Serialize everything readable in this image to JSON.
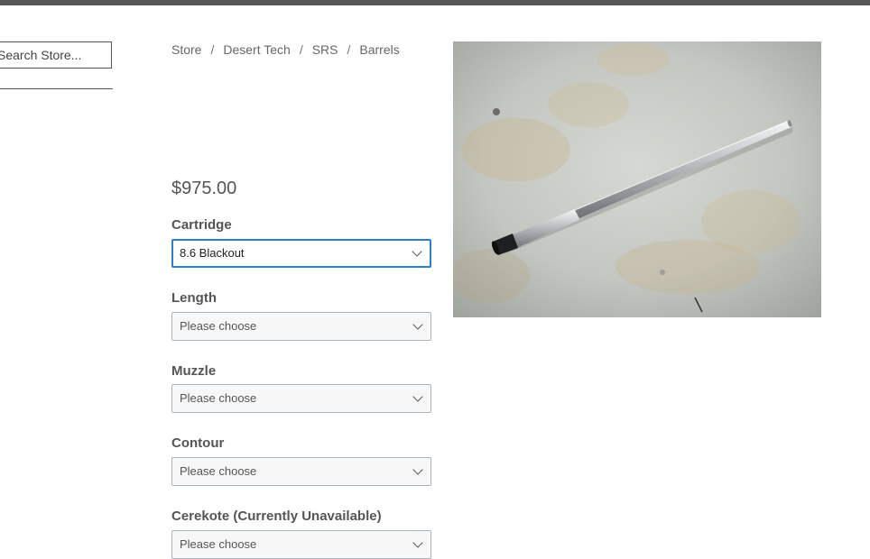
{
  "search": {
    "placeholder": "Search Store..."
  },
  "breadcrumb": {
    "items": [
      "Store",
      "Desert Tech",
      "SRS",
      "Barrels"
    ],
    "separator": "/"
  },
  "product": {
    "price": "$975.00",
    "image_alt": "Stainless rifle barrel on concrete floor"
  },
  "options": [
    {
      "label": "Cartridge",
      "value": "8.6 Blackout"
    },
    {
      "label": "Length",
      "value": "Please choose"
    },
    {
      "label": "Muzzle",
      "value": "Please choose"
    },
    {
      "label": "Contour",
      "value": "Please choose"
    },
    {
      "label": "Cerekote (Currently Unavailable)",
      "value": "Please choose"
    }
  ],
  "colors": {
    "topbar": "#555555",
    "focus_border": "#2f7ec1",
    "text": "#555555"
  },
  "icons": {
    "select_arrow": "chevron-down-icon"
  }
}
